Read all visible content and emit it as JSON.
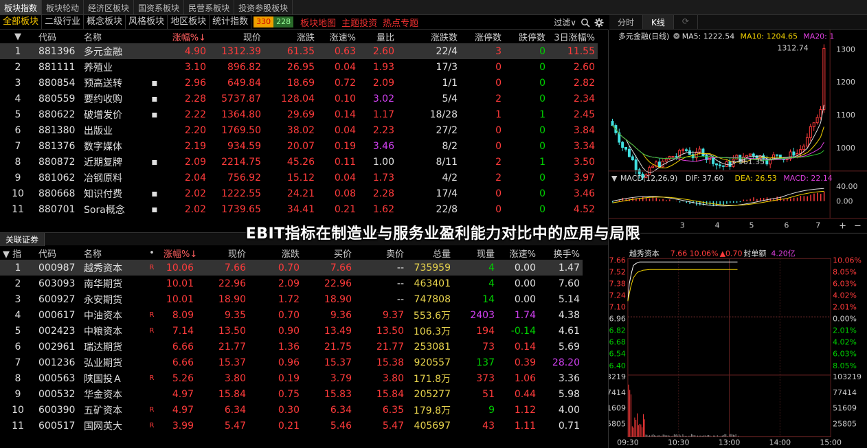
{
  "top_tabs": [
    "板块指数",
    "板块轮动",
    "经济区板块",
    "国资系板块",
    "民营系板块",
    "投资参股板块"
  ],
  "filter_tabs": [
    "全部板块",
    "二级行业",
    "概念板块",
    "风格板块",
    "地区板块",
    "统计指数"
  ],
  "badges": {
    "up": "330",
    "down": "228"
  },
  "red_links": [
    "板块地图",
    "主题投资",
    "热点专题"
  ],
  "filter_label": "过滤∨",
  "right_tabs": [
    "分时",
    "K线"
  ],
  "sector": {
    "headers": [
      "代码",
      "名称",
      "涨幅%↓",
      "现价",
      "涨跌",
      "涨速%",
      "量比",
      "涨跌数",
      "涨停数",
      "跌停数",
      "3日涨幅%"
    ],
    "rows": [
      {
        "n": "1",
        "code": "881396",
        "name": "多元金融",
        "dot": "",
        "pct": "4.90",
        "price": "1312.39",
        "chg": "61.35",
        "spd": "0.63",
        "vr": "2.60",
        "vrc": "red",
        "ud": "22/4",
        "lu": "3",
        "ld": "0",
        "d3": "11.55"
      },
      {
        "n": "2",
        "code": "881111",
        "name": "养殖业",
        "dot": "",
        "pct": "3.10",
        "price": "896.82",
        "chg": "26.95",
        "spd": "0.04",
        "vr": "1.93",
        "vrc": "red",
        "ud": "17/3",
        "lu": "0",
        "ld": "0",
        "d3": "2.60"
      },
      {
        "n": "3",
        "code": "880854",
        "name": "预高送转",
        "dot": "▪",
        "pct": "2.96",
        "price": "649.84",
        "chg": "18.69",
        "spd": "0.72",
        "vr": "2.09",
        "vrc": "red",
        "ud": "1/1",
        "lu": "0",
        "ld": "0",
        "d3": "2.82"
      },
      {
        "n": "4",
        "code": "880559",
        "name": "要约收购",
        "dot": "▪",
        "pct": "2.28",
        "price": "5737.87",
        "chg": "128.04",
        "spd": "0.10",
        "vr": "3.02",
        "vrc": "magenta",
        "ud": "5/4",
        "lu": "2",
        "ld": "0",
        "d3": "2.34"
      },
      {
        "n": "5",
        "code": "880622",
        "name": "破增发价",
        "dot": "▪",
        "pct": "2.22",
        "price": "1364.80",
        "chg": "29.69",
        "spd": "0.14",
        "vr": "1.17",
        "vrc": "red",
        "ud": "18/28",
        "lu": "1",
        "ld": "1",
        "d3": "2.45"
      },
      {
        "n": "6",
        "code": "881380",
        "name": "出版业",
        "dot": "",
        "pct": "2.20",
        "price": "1769.50",
        "chg": "38.02",
        "spd": "0.04",
        "vr": "2.23",
        "vrc": "red",
        "ud": "27/2",
        "lu": "0",
        "ld": "0",
        "d3": "3.84"
      },
      {
        "n": "7",
        "code": "881376",
        "name": "数字媒体",
        "dot": "",
        "pct": "2.19",
        "price": "934.59",
        "chg": "20.07",
        "spd": "0.19",
        "vr": "3.46",
        "vrc": "magenta",
        "ud": "8/2",
        "lu": "0",
        "ld": "0",
        "d3": "3.34"
      },
      {
        "n": "8",
        "code": "880872",
        "name": "近期复牌",
        "dot": "▪",
        "pct": "2.09",
        "price": "2214.75",
        "chg": "45.26",
        "spd": "0.11",
        "vr": "1.00",
        "vrc": "white",
        "ud": "8/11",
        "lu": "2",
        "ld": "1",
        "d3": "3.50"
      },
      {
        "n": "9",
        "code": "881062",
        "name": "冶钢原料",
        "dot": "",
        "pct": "2.04",
        "price": "756.92",
        "chg": "15.12",
        "spd": "0.04",
        "vr": "1.73",
        "vrc": "red",
        "ud": "4/2",
        "lu": "2",
        "ld": "0",
        "d3": "3.97"
      },
      {
        "n": "10",
        "code": "880668",
        "name": "知识付费",
        "dot": "▪",
        "pct": "2.02",
        "price": "1222.55",
        "chg": "24.21",
        "spd": "0.08",
        "vr": "2.28",
        "vrc": "red",
        "ud": "17/4",
        "lu": "0",
        "ld": "0",
        "d3": "3.46"
      },
      {
        "n": "11",
        "code": "880701",
        "name": "Sora概念",
        "dot": "▪",
        "pct": "2.02",
        "price": "1739.65",
        "chg": "34.41",
        "spd": "0.21",
        "vr": "1.62",
        "vrc": "red",
        "ud": "22/8",
        "lu": "0",
        "ld": "0",
        "d3": "4.52"
      }
    ]
  },
  "stock_tab": "关联证券",
  "stock": {
    "headers": [
      "指",
      "代码",
      "名称",
      "•",
      "涨幅%↓",
      "现价",
      "涨跌",
      "买价",
      "卖价",
      "总量",
      "现量",
      "涨速%",
      "换手%"
    ],
    "rows": [
      {
        "n": "1",
        "code": "000987",
        "name": "越秀资本",
        "r": "R",
        "pct": "10.06",
        "price": "7.66",
        "chg": "0.70",
        "bid": "7.66",
        "ask": "--",
        "vol": "735959",
        "cur": "4",
        "curc": "green",
        "spd": "0.00",
        "spdc": "white",
        "turn": "1.47",
        "turnc": "white"
      },
      {
        "n": "2",
        "code": "603093",
        "name": "南华期货",
        "r": "",
        "pct": "10.01",
        "price": "22.96",
        "chg": "2.09",
        "bid": "22.96",
        "ask": "--",
        "vol": "463401",
        "cur": "4",
        "curc": "green",
        "spd": "0.00",
        "spdc": "white",
        "turn": "7.60",
        "turnc": "white"
      },
      {
        "n": "3",
        "code": "600927",
        "name": "永安期货",
        "r": "",
        "pct": "10.01",
        "price": "18.90",
        "chg": "1.72",
        "bid": "18.90",
        "ask": "--",
        "vol": "747808",
        "cur": "14",
        "curc": "green",
        "spd": "0.00",
        "spdc": "white",
        "turn": "5.14",
        "turnc": "white"
      },
      {
        "n": "4",
        "code": "000617",
        "name": "中油资本",
        "r": "R",
        "pct": "8.09",
        "price": "9.35",
        "chg": "0.70",
        "bid": "9.36",
        "ask": "9.37",
        "vol": "553.6万",
        "cur": "2403",
        "curc": "magenta",
        "spd": "1.74",
        "spdc": "magenta",
        "turn": "4.38",
        "turnc": "white"
      },
      {
        "n": "5",
        "code": "002423",
        "name": "中粮资本",
        "r": "R",
        "pct": "7.14",
        "price": "13.50",
        "chg": "0.90",
        "bid": "13.49",
        "ask": "13.50",
        "vol": "106.3万",
        "cur": "194",
        "curc": "red",
        "spd": "-0.14",
        "spdc": "green",
        "turn": "4.61",
        "turnc": "white"
      },
      {
        "n": "6",
        "code": "002961",
        "name": "瑞达期货",
        "r": "",
        "pct": "6.66",
        "price": "21.77",
        "chg": "1.36",
        "bid": "21.75",
        "ask": "21.77",
        "vol": "253081",
        "cur": "73",
        "curc": "red",
        "spd": "0.14",
        "spdc": "red",
        "turn": "5.69",
        "turnc": "white"
      },
      {
        "n": "7",
        "code": "001236",
        "name": "弘业期货",
        "r": "",
        "pct": "6.66",
        "price": "15.37",
        "chg": "0.96",
        "bid": "15.37",
        "ask": "15.38",
        "vol": "920557",
        "cur": "137",
        "curc": "green",
        "spd": "0.39",
        "spdc": "red",
        "turn": "28.20",
        "turnc": "magenta"
      },
      {
        "n": "8",
        "code": "000563",
        "name": "陕国投Ａ",
        "r": "R",
        "pct": "5.26",
        "price": "3.80",
        "chg": "0.19",
        "bid": "3.79",
        "ask": "3.80",
        "vol": "171.8万",
        "cur": "373",
        "curc": "red",
        "spd": "1.06",
        "spdc": "red",
        "turn": "3.36",
        "turnc": "white"
      },
      {
        "n": "9",
        "code": "000532",
        "name": "华金资本",
        "r": "",
        "pct": "4.97",
        "price": "15.84",
        "chg": "0.75",
        "bid": "15.83",
        "ask": "15.84",
        "vol": "205277",
        "cur": "51",
        "curc": "red",
        "spd": "0.44",
        "spdc": "red",
        "turn": "5.98",
        "turnc": "white"
      },
      {
        "n": "10",
        "code": "600390",
        "name": "五矿资本",
        "r": "R",
        "pct": "4.97",
        "price": "6.34",
        "chg": "0.30",
        "bid": "6.34",
        "ask": "6.35",
        "vol": "179.8万",
        "cur": "9",
        "curc": "green",
        "spd": "1.12",
        "spdc": "red",
        "turn": "4.00",
        "turnc": "white"
      },
      {
        "n": "11",
        "code": "600517",
        "name": "国网英大",
        "r": "R",
        "pct": "3.99",
        "price": "5.47",
        "chg": "0.21",
        "bid": "5.46",
        "ask": "5.47",
        "vol": "405697",
        "cur": "43",
        "curc": "red",
        "spd": "1.11",
        "spdc": "red",
        "turn": "0.71",
        "turnc": "white"
      }
    ]
  },
  "kline": {
    "title": "多元金融(日线)",
    "ma5": "MA5: 1222.54",
    "ma10": "MA10: 1204.65",
    "ma20": "MA20: 1",
    "y_ticks": [
      "1300",
      "1200",
      "1100",
      "1000"
    ],
    "high_label": "1312.74",
    "low_label": "961.35",
    "macd_title": "MACD(12,26,9)",
    "dif": "DIF: 37.60",
    "dea": "DEA: 26.53",
    "macd": "MACD: 22.14",
    "macd_ticks": [
      "40.00",
      "0.00"
    ],
    "x_ticks": [
      "3",
      "4",
      "5",
      "6",
      "7"
    ],
    "zoom_plus": "+",
    "zoom_minus": "−"
  },
  "intraday": {
    "name": "越秀资本",
    "price": "7.66",
    "pct": "10.06%",
    "chg": "▲0.70",
    "seal_label": "封单额",
    "seal": "4.20亿",
    "left_ticks": [
      "7.66",
      "7.52",
      "7.38",
      "7.24",
      "7.10",
      "6.96",
      "6.82",
      "6.68",
      "6.54",
      "6.40"
    ],
    "right_ticks": [
      "10.06%",
      "8.05%",
      "6.03%",
      "4.02%",
      "2.01%",
      "0.00%",
      "2.01%",
      "4.02%",
      "6.03%",
      "8.05%"
    ],
    "vol_ticks": [
      "103219",
      "77414",
      "51609",
      "25805"
    ],
    "time_ticks": [
      "09:30",
      "10:30",
      "13:00",
      "14:00",
      "15:00"
    ]
  },
  "overlay_title": "EBIT指标在制造业与服务业盈利能力对比中的应用与局限"
}
